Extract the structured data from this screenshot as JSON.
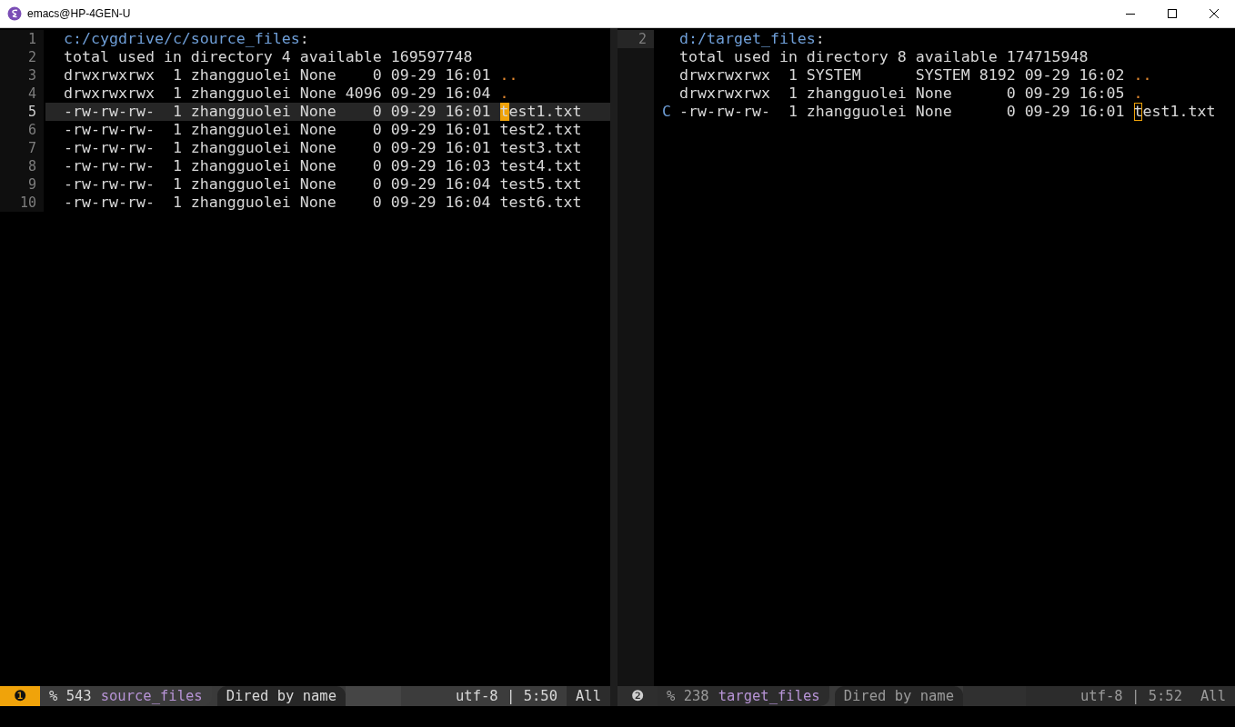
{
  "window": {
    "title": "emacs@HP-4GEN-U"
  },
  "panes": [
    {
      "active": true,
      "line_numbers": [
        "1",
        "2",
        "3",
        "4",
        "5",
        "6",
        "7",
        "8",
        "9",
        "10"
      ],
      "lines": [
        {
          "kind": "header",
          "path": "c:/cygdrive/c/source_files",
          "suffix": ":",
          "current": false
        },
        {
          "kind": "text",
          "text": "total used in directory 4 available 169597748",
          "current": false
        },
        {
          "kind": "entry",
          "info": "drwxrwxrwx  1 zhangguolei None    0 09-29 16:01",
          "name": "..",
          "is_directory": true,
          "cursor": false,
          "current": false
        },
        {
          "kind": "entry",
          "info": "drwxrwxrwx  1 zhangguolei None 4096 09-29 16:04",
          "name": ".",
          "is_directory": true,
          "cursor": false,
          "current": false
        },
        {
          "kind": "entry",
          "info": "-rw-rw-rw-  1 zhangguolei None    0 09-29 16:01",
          "name": "test1.txt",
          "is_directory": false,
          "cursor": true,
          "current": true
        },
        {
          "kind": "entry",
          "info": "-rw-rw-rw-  1 zhangguolei None    0 09-29 16:01",
          "name": "test2.txt",
          "is_directory": false,
          "cursor": false,
          "current": false
        },
        {
          "kind": "entry",
          "info": "-rw-rw-rw-  1 zhangguolei None    0 09-29 16:01",
          "name": "test3.txt",
          "is_directory": false,
          "cursor": false,
          "current": false
        },
        {
          "kind": "entry",
          "info": "-rw-rw-rw-  1 zhangguolei None    0 09-29 16:03",
          "name": "test4.txt",
          "is_directory": false,
          "cursor": false,
          "current": false
        },
        {
          "kind": "entry",
          "info": "-rw-rw-rw-  1 zhangguolei None    0 09-29 16:04",
          "name": "test5.txt",
          "is_directory": false,
          "cursor": false,
          "current": false
        },
        {
          "kind": "entry",
          "info": "-rw-rw-rw-  1 zhangguolei None    0 09-29 16:04",
          "name": "test6.txt",
          "is_directory": false,
          "cursor": false,
          "current": false
        }
      ],
      "mode_line": {
        "window_number": "❶",
        "size": "% 543",
        "buffer": "source_files",
        "mode": "Dired by name",
        "encoding": "utf-8 | 5:50",
        "position": "All"
      }
    },
    {
      "active": false,
      "line_numbers": [
        "2"
      ],
      "lines": [
        {
          "kind": "header",
          "path": "d:/target_files",
          "suffix": ":"
        },
        {
          "kind": "text",
          "text": "total used in directory 8 available 174715948"
        },
        {
          "kind": "entry",
          "info": "drwxrwxrwx  1 SYSTEM      SYSTEM 8192 09-29 16:02",
          "name": "..",
          "is_directory": true,
          "cursor": false
        },
        {
          "kind": "entry",
          "info": "drwxrwxrwx  1 zhangguolei None      0 09-29 16:05",
          "name": ".",
          "is_directory": true,
          "cursor": false
        },
        {
          "kind": "entry",
          "mark": "C",
          "info": "-rw-rw-rw-  1 zhangguolei None      0 09-29 16:01",
          "name": "test1.txt",
          "is_directory": false,
          "cursor": true
        }
      ],
      "mode_line": {
        "window_number": "❷",
        "size": "% 238",
        "buffer": "target_files",
        "mode": "Dired by name",
        "encoding": "utf-8 | 5:52",
        "position": "All"
      }
    }
  ]
}
